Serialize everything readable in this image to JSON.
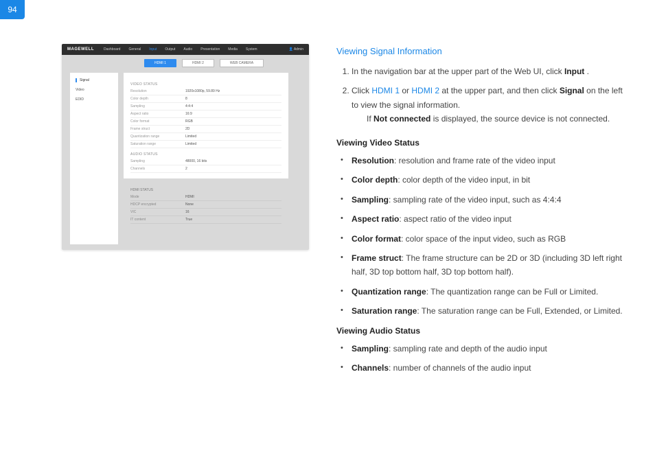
{
  "page_number": "94",
  "screenshot": {
    "logo": "MAGEWELL",
    "nav": [
      "Dashboard",
      "General",
      "Input",
      "Output",
      "Audio",
      "Presentation",
      "Media",
      "System"
    ],
    "nav_active_index": 2,
    "user": "Admin",
    "tabs": [
      "HDMI 1",
      "HDMI 2",
      "WEB CAMERA"
    ],
    "tab_active_index": 0,
    "sidebar": [
      "Signal",
      "Video",
      "EDID"
    ],
    "video_status_title": "VIDEO STATUS",
    "video_rows": [
      {
        "k": "Resolution",
        "v": "1920x1080p, 59.89 Hz"
      },
      {
        "k": "Color depth",
        "v": "8"
      },
      {
        "k": "Sampling",
        "v": "4:4:4"
      },
      {
        "k": "Aspect ratio",
        "v": "16:9"
      },
      {
        "k": "Color format",
        "v": "RGB"
      },
      {
        "k": "Frame struct",
        "v": "2D"
      },
      {
        "k": "Quantization range",
        "v": "Limited"
      },
      {
        "k": "Saturation range",
        "v": "Limited"
      }
    ],
    "audio_status_title": "AUDIO STATUS",
    "audio_rows": [
      {
        "k": "Sampling",
        "v": "48000, 16 bits"
      },
      {
        "k": "Channels",
        "v": "2"
      }
    ],
    "hdmi_status_title": "HDMI STATUS",
    "hdmi_rows": [
      {
        "k": "Mode",
        "v": "HDMI"
      },
      {
        "k": "HDCP encrypted",
        "v": "None"
      },
      {
        "k": "VIC",
        "v": "16"
      },
      {
        "k": "IT content",
        "v": "True"
      }
    ]
  },
  "doc": {
    "heading": "Viewing Signal Information",
    "step1_a": "In the navigation bar at the upper part of the Web UI, click ",
    "step1_b": "Input",
    "step1_c": " .",
    "step2_a": "Click ",
    "step2_b": "HDMI 1",
    "step2_c": " or ",
    "step2_d": "HDMI 2",
    "step2_e": " at the upper part, and then click ",
    "step2_f": "Signal",
    "step2_g": " on the left to view the signal information.",
    "step2_note_a": "If ",
    "step2_note_b": "Not connected",
    "step2_note_c": " is displayed, the source device is not connected.",
    "video_heading": "Viewing Video Status",
    "v1_a": "Resolution",
    "v1_b": ": resolution and frame rate of the video input",
    "v2_a": "Color depth",
    "v2_b": ": color depth of the video input, in bit",
    "v3_a": "Sampling",
    "v3_b": ": sampling rate of the video input, such as 4:4:4",
    "v4_a": "Aspect ratio",
    "v4_b": ": aspect ratio of the video input",
    "v5_a": "Color format",
    "v5_b": ": color space of the input video, such as RGB",
    "v6_a": "Frame struct",
    "v6_b": ": The frame structure can be 2D or 3D (including 3D left right half, 3D top bottom half, 3D top bottom half).",
    "v7_a": "Quantization range",
    "v7_b": ": The quantization range can be Full or Limited.",
    "v8_a": "Saturation range",
    "v8_b": ": The saturation range can be Full, Extended, or Limited.",
    "audio_heading": "Viewing Audio Status",
    "a1_a": "Sampling",
    "a1_b": ": sampling rate and depth of the audio input",
    "a2_a": "Channels",
    "a2_b": ": number of channels of the audio input"
  }
}
